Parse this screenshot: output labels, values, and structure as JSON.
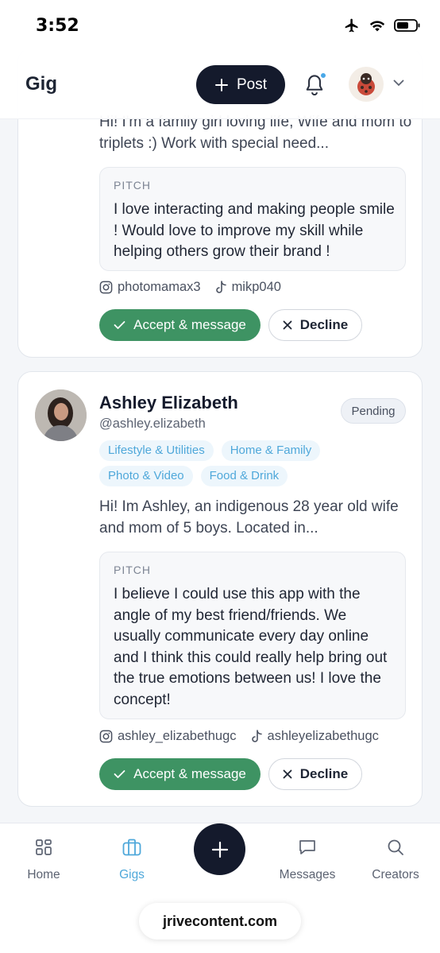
{
  "status_bar": {
    "time": "3:52"
  },
  "header": {
    "brand": "Gig",
    "post_label": "Post"
  },
  "cards": [
    {
      "bio": "Hi! I'm a family girl loving life, Wife and mom to triplets :) Work with special need...",
      "pitch_label": "PITCH",
      "pitch": "I love interacting and making people smile ! Would love to improve my skill while helping others grow their brand !",
      "instagram": "photomamax3",
      "tiktok": "mikp040",
      "accept_label": "Accept & message",
      "decline_label": "Decline"
    },
    {
      "name": "Ashley Elizabeth",
      "handle": "@ashley.elizabeth",
      "status": "Pending",
      "tags": [
        "Lifestyle & Utilities",
        "Home & Family",
        "Photo & Video",
        "Food & Drink"
      ],
      "bio": "Hi! Im Ashley, an indigenous 28 year old wife and mom of 5 boys. Located in...",
      "pitch_label": "PITCH",
      "pitch": "I believe I could use this app with the angle of my best friend/friends. We usually communicate every day online and I think this could really help bring out the true emotions between us! I love the concept!",
      "instagram": "ashley_elizabethugc",
      "tiktok": "ashleyelizabethugc",
      "accept_label": "Accept & message",
      "decline_label": "Decline"
    }
  ],
  "tab_bar": {
    "tabs": [
      {
        "label": "Home",
        "icon": "grid-icon"
      },
      {
        "label": "Gigs",
        "icon": "briefcase-icon",
        "active": true
      },
      {
        "label": "Messages",
        "icon": "chat-icon"
      },
      {
        "label": "Creators",
        "icon": "search-icon"
      }
    ]
  },
  "browser": {
    "url": "jrivecontent.com"
  },
  "colors": {
    "accent": "#4fa8da",
    "accept": "#3e9363",
    "dark": "#141a2c"
  }
}
